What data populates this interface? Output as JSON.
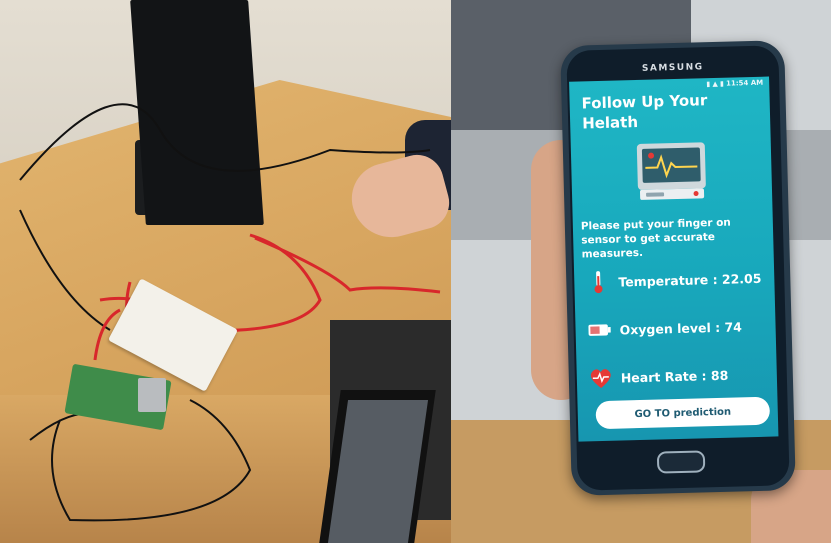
{
  "app": {
    "title": "Follow Up Your Helath",
    "instructions": "Please put your finger on sensor to get accurate measures.",
    "measurements": [
      {
        "label": "Temperature : 22.05",
        "icon": "thermometer-icon"
      },
      {
        "label": "Oxygen level : 74",
        "icon": "battery-icon"
      },
      {
        "label": "Heart Rate : 88",
        "icon": "heart-pulse-icon"
      }
    ],
    "action_button": "GO TO prediction"
  },
  "phone": {
    "brand": "SAMSUNG",
    "status_time": "11:54 AM"
  },
  "colors": {
    "screen_top": "#1fb6c5",
    "screen_bottom": "#1796b0",
    "wire_red": "#d8272b",
    "desk_wood": "#d8a660",
    "pi_board": "#3f8c4a"
  }
}
